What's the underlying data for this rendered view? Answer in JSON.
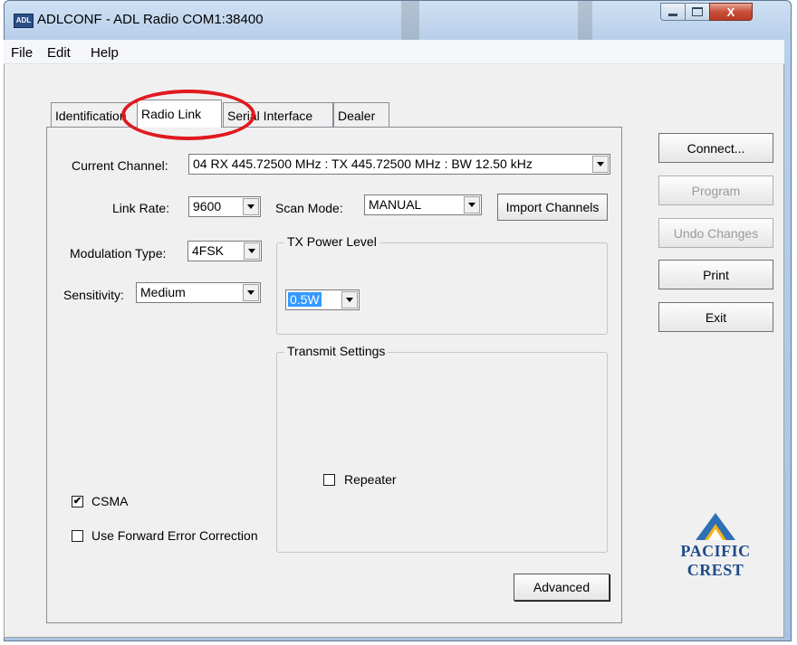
{
  "window": {
    "app_icon_label": "ADL",
    "title": "ADLCONF - ADL Radio COM1:38400",
    "close_glyph": "X"
  },
  "menu": [
    "File",
    "Edit",
    "Help"
  ],
  "tabs": [
    "Identification",
    "Radio Link",
    "Serial Interface",
    "Dealer"
  ],
  "active_tab": "Radio Link",
  "radio_link": {
    "current_channel_label": "Current Channel:",
    "current_channel_value": "04  RX 445.72500 MHz : TX 445.72500 MHz : BW 12.50 kHz",
    "link_rate_label": "Link Rate:",
    "link_rate_value": "9600",
    "scan_mode_label": "Scan Mode:",
    "scan_mode_value": "MANUAL",
    "import_channels_label": "Import Channels",
    "modulation_label": "Modulation Type:",
    "modulation_value": "4FSK",
    "sensitivity_label": "Sensitivity:",
    "sensitivity_value": "Medium",
    "tx_power_group_label": "TX Power Level",
    "tx_power_value": "0.5W",
    "transmit_settings_label": "Transmit Settings",
    "repeater_label": "Repeater",
    "repeater_checked": false,
    "csma_label": "CSMA",
    "csma_checked": true,
    "fec_label": "Use Forward Error Correction",
    "fec_checked": false,
    "advanced_label": "Advanced"
  },
  "side_buttons": {
    "connect": "Connect...",
    "program": "Program",
    "undo": "Undo Changes",
    "print": "Print",
    "exit": "Exit"
  },
  "logo": {
    "text": "PACIFIC CREST",
    "color": "#1e4a8a"
  },
  "annotation_color": "#e0191f"
}
